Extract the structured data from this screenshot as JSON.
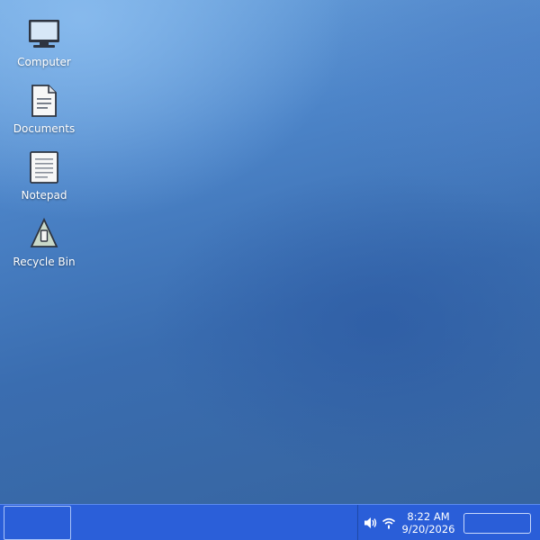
{
  "desktop": {
    "icons": [
      {
        "label": "Computer",
        "icon": "computer-icon"
      },
      {
        "label": "Documents",
        "icon": "document-icon"
      },
      {
        "label": "Notepad",
        "icon": "notepad-icon"
      },
      {
        "label": "Recycle Bin",
        "icon": "recycle-bin-icon"
      }
    ]
  },
  "taskbar": {
    "tray": {
      "volume_icon": "volume-icon",
      "network_icon": "wifi-icon"
    },
    "clock": {
      "time": "8:22 AM",
      "date": "9/20/2026"
    }
  },
  "colors": {
    "taskbar": "#2a5ed8",
    "desktop_light": "#6fa6df",
    "desktop_dark": "#36649f",
    "text": "#ffffff"
  }
}
